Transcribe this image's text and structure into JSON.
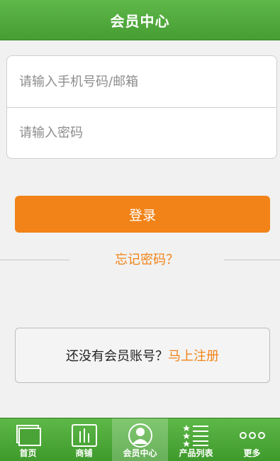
{
  "header": {
    "title": "会员中心"
  },
  "login_form": {
    "username_placeholder": "请输入手机号码/邮箱",
    "password_placeholder": "请输入密码",
    "login_label": "登录",
    "forgot_label": "忘记密码？"
  },
  "register": {
    "prompt": "还没有会员账号？",
    "link_label": "马上注册"
  },
  "tabbar": {
    "active_tab": "会员中心",
    "items": [
      {
        "label": "首页",
        "icon": "home-icon"
      },
      {
        "label": "商铺",
        "icon": "shop-icon"
      },
      {
        "label": "会员中心",
        "icon": "member-icon"
      },
      {
        "label": "产品列表",
        "icon": "product-list-icon"
      },
      {
        "label": "更多",
        "icon": "more-icon"
      }
    ]
  },
  "colors": {
    "brand_green": "#4aa336",
    "accent_orange": "#f18318",
    "background": "#f1f1f1"
  }
}
